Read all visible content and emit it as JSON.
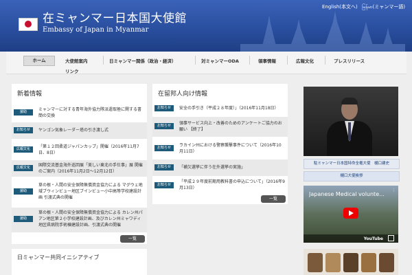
{
  "header": {
    "title_ja": "在ミャンマー日本国大使館",
    "title_en": "Embassy of Japan in Myanmar",
    "lang_en": "English(本文へ)",
    "lang_my": "မြန်မာ(ミャンマー語)"
  },
  "nav": {
    "items": [
      "ホーム",
      "大使館案内",
      "日ミャンマー関係（政治・経済）",
      "対ミャンマーODA",
      "領事情報",
      "広報文化",
      "プレスリリース"
    ],
    "link_label": "リンク"
  },
  "news": {
    "title": "新着情報",
    "items": [
      {
        "tag": "援助",
        "text": "ミャンマーに対する青年海外協力隊派遣取極に関する書簡の交換"
      },
      {
        "tag": "お知らせ",
        "text": "ヤンゴン気象レーダー塔の引き渡し式"
      },
      {
        "tag": "広報文化",
        "text": "「第１２回柔道ジャパンカップ」開催（2016年11月7日、8日）"
      },
      {
        "tag": "広報文化",
        "text": "国際交流基金海外巡回展「美しい東北の手仕事」展 開催のご案内（2016年11月2日〜12月12日）"
      },
      {
        "tag": "援助",
        "text": "草の根・人間の安全保障無償資金協力による マグウェ地域ブウィンビュー地区ブインビュー小中高等学校建設計画 引渡式典の開催"
      },
      {
        "tag": "援助",
        "text": "草の根・人間の安全保障無償資金協力による カレン州パアン地区第２小学校建設計画、及びカレン州ミャワディ地区県病院手術棟建設計画、引渡式典の開催"
      }
    ],
    "more_label": "一覧"
  },
  "residents": {
    "title": "在留邦人向け情報",
    "items": [
      {
        "tag": "お知らせ",
        "text": "安全の手引き（平成２８年度）」（2016年11月18日）"
      },
      {
        "tag": "お知らせ",
        "text": "領事サービス向上・改善のためのアンケートご協力のお願い 【終了】"
      },
      {
        "tag": "お知らせ",
        "text": "ラカイン州における警察襲撃事件について（2016年10月11日）"
      },
      {
        "tag": "お知らせ",
        "text": "「補欠選挙に伴う在外選挙の実施」"
      },
      {
        "tag": "お知らせ",
        "text": "「平成２９年度前期用教科書の申込について」（2016年9月13日）"
      }
    ],
    "more_label": "一覧"
  },
  "sidebar": {
    "ambassador_name": "駐ミャンマー日本国特命全権大使　樋口建史",
    "greeting_link": "樋口大使挨拶",
    "video_title": "Japanese Medical volunte...",
    "video_brand": "YouTube"
  },
  "initiative": {
    "title": "日ミャンマー共同イニシアティブ"
  },
  "colors": {
    "header_blue": "#2a4f9f",
    "tag_teal": "#1e5b7a",
    "flag_red": "#c8102e"
  }
}
